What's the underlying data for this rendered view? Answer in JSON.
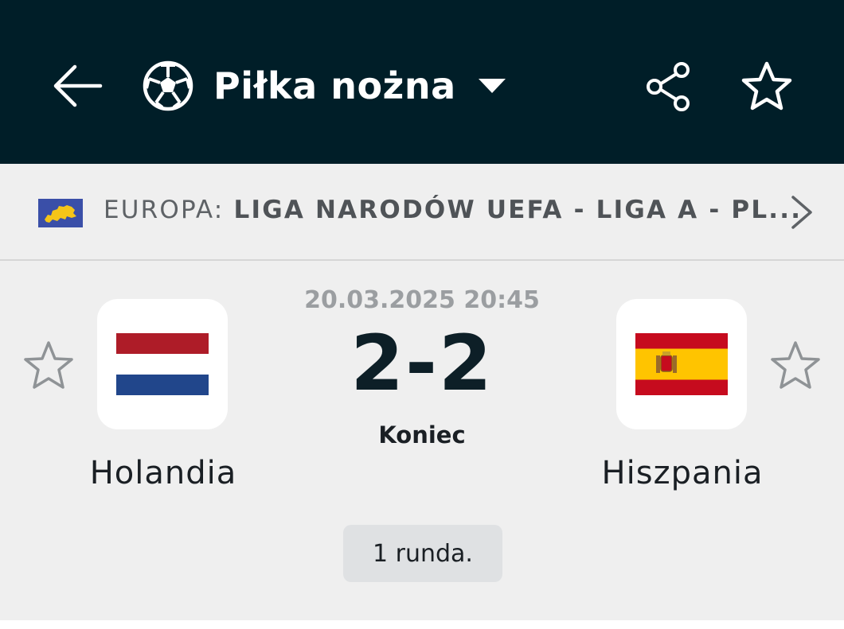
{
  "header": {
    "sport_title": "Piłka nożna",
    "icons": [
      "arrow-back-icon",
      "football-icon",
      "caret-down-icon",
      "share-icon",
      "star-outline-icon"
    ],
    "background": "#001e28"
  },
  "league": {
    "country": "EUROPA:",
    "name": "LIGA NARODÓW UEFA - LIGA A - PL..."
  },
  "match": {
    "datetime": "20.03.2025 20:45",
    "score": "2-2",
    "status": "Koniec",
    "round": "1 runda.",
    "home_team": {
      "name": "Holandia",
      "flag": "netherlands-flag"
    },
    "away_team": {
      "name": "Hiszpania",
      "flag": "spain-flag"
    }
  },
  "colors": {
    "nl_red": "#ae1c28",
    "nl_blue": "#21468b",
    "es_red": "#c60b1e",
    "es_yellow": "#ffc400",
    "eu_blue": "#3a4fa8"
  }
}
